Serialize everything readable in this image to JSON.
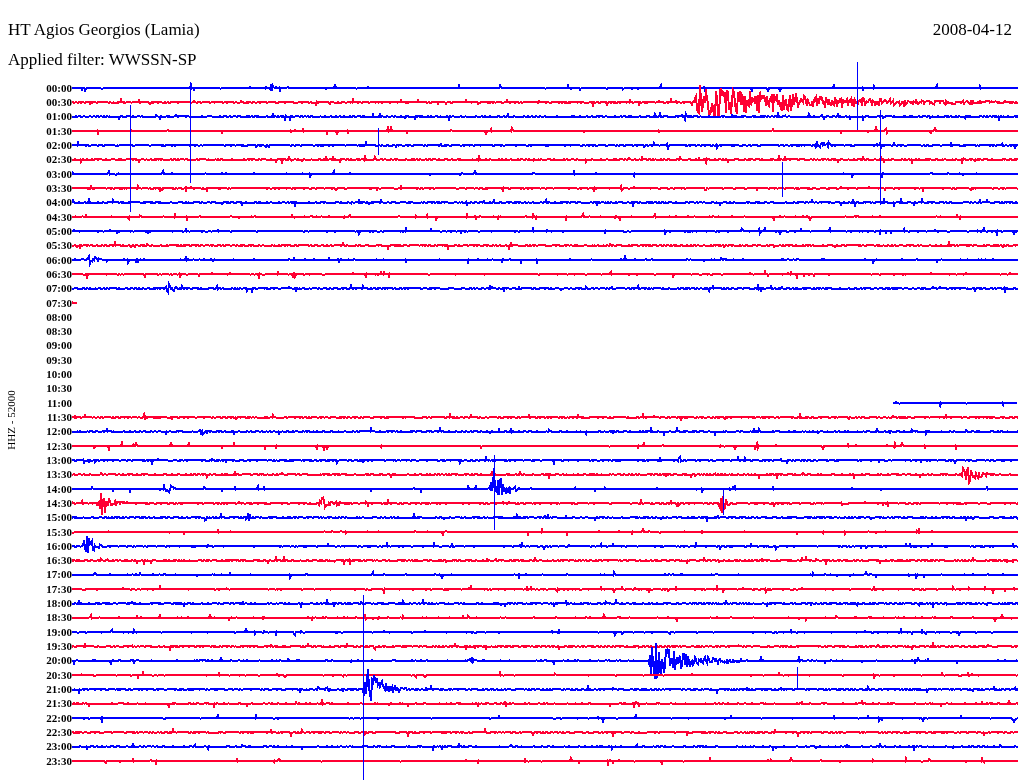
{
  "station": {
    "title": "HT Agios Georgios (Lamia)",
    "date": "2008-04-12",
    "filter": "Applied filter: WWSSN-SP"
  },
  "axis_label": "HHZ - 52000",
  "rows": [
    {
      "time": "00:00",
      "color": "#0000ff",
      "kind": "full"
    },
    {
      "time": "00:30",
      "color": "#ff0033",
      "kind": "full"
    },
    {
      "time": "01:00",
      "color": "#0000ff",
      "kind": "full"
    },
    {
      "time": "01:30",
      "color": "#ff0033",
      "kind": "full"
    },
    {
      "time": "02:00",
      "color": "#0000ff",
      "kind": "full"
    },
    {
      "time": "02:30",
      "color": "#ff0033",
      "kind": "full"
    },
    {
      "time": "03:00",
      "color": "#0000ff",
      "kind": "full"
    },
    {
      "time": "03:30",
      "color": "#ff0033",
      "kind": "full"
    },
    {
      "time": "04:00",
      "color": "#0000ff",
      "kind": "full"
    },
    {
      "time": "04:30",
      "color": "#ff0033",
      "kind": "full"
    },
    {
      "time": "05:00",
      "color": "#0000ff",
      "kind": "full"
    },
    {
      "time": "05:30",
      "color": "#ff0033",
      "kind": "full"
    },
    {
      "time": "06:00",
      "color": "#0000ff",
      "kind": "full"
    },
    {
      "time": "06:30",
      "color": "#ff0033",
      "kind": "full"
    },
    {
      "time": "07:00",
      "color": "#0000ff",
      "kind": "full"
    },
    {
      "time": "07:30",
      "color": "#ff0033",
      "kind": "head"
    },
    {
      "time": "08:00",
      "kind": "none"
    },
    {
      "time": "08:30",
      "kind": "none"
    },
    {
      "time": "09:00",
      "kind": "none"
    },
    {
      "time": "09:30",
      "kind": "none"
    },
    {
      "time": "10:00",
      "kind": "none"
    },
    {
      "time": "10:30",
      "kind": "none"
    },
    {
      "time": "11:00",
      "color": "#0000ff",
      "kind": "tail"
    },
    {
      "time": "11:30",
      "color": "#ff0033",
      "kind": "full"
    },
    {
      "time": "12:00",
      "color": "#0000ff",
      "kind": "full"
    },
    {
      "time": "12:30",
      "color": "#ff0033",
      "kind": "full"
    },
    {
      "time": "13:00",
      "color": "#0000ff",
      "kind": "full"
    },
    {
      "time": "13:30",
      "color": "#ff0033",
      "kind": "full"
    },
    {
      "time": "14:00",
      "color": "#0000ff",
      "kind": "full"
    },
    {
      "time": "14:30",
      "color": "#ff0033",
      "kind": "full"
    },
    {
      "time": "15:00",
      "color": "#0000ff",
      "kind": "full"
    },
    {
      "time": "15:30",
      "color": "#ff0033",
      "kind": "full"
    },
    {
      "time": "16:00",
      "color": "#0000ff",
      "kind": "full"
    },
    {
      "time": "16:30",
      "color": "#ff0033",
      "kind": "full"
    },
    {
      "time": "17:00",
      "color": "#0000ff",
      "kind": "full"
    },
    {
      "time": "17:30",
      "color": "#ff0033",
      "kind": "full"
    },
    {
      "time": "18:00",
      "color": "#0000ff",
      "kind": "full"
    },
    {
      "time": "18:30",
      "color": "#ff0033",
      "kind": "full"
    },
    {
      "time": "19:00",
      "color": "#0000ff",
      "kind": "full"
    },
    {
      "time": "19:30",
      "color": "#ff0033",
      "kind": "full"
    },
    {
      "time": "20:00",
      "color": "#0000ff",
      "kind": "full"
    },
    {
      "time": "20:30",
      "color": "#ff0033",
      "kind": "full"
    },
    {
      "time": "21:00",
      "color": "#0000ff",
      "kind": "full"
    },
    {
      "time": "21:30",
      "color": "#ff0033",
      "kind": "full"
    },
    {
      "time": "22:00",
      "color": "#0000ff",
      "kind": "full"
    },
    {
      "time": "22:30",
      "color": "#ff0033",
      "kind": "full"
    },
    {
      "time": "23:00",
      "color": "#0000ff",
      "kind": "full"
    },
    {
      "time": "23:30",
      "color": "#ff0033",
      "kind": "full"
    }
  ]
}
